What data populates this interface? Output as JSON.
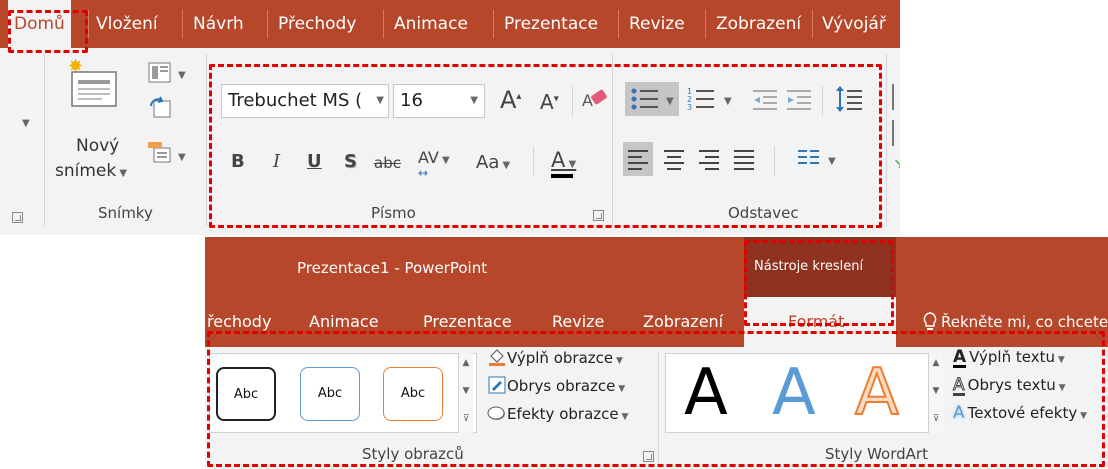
{
  "top": {
    "tabs": [
      "Domů",
      "Vložení",
      "Návrh",
      "Přechody",
      "Animace",
      "Prezentace",
      "Revize",
      "Zobrazení",
      "Vývojář"
    ],
    "slides_group": {
      "new_slide_line1": "Nový",
      "new_slide_line2": "snímek",
      "label": "Snímky"
    },
    "font_group": {
      "font_name": "Trebuchet MS (",
      "font_size": "16",
      "bold": "B",
      "italic": "I",
      "underline": "U",
      "shadow": "S",
      "strikethrough": "abc",
      "spacing": "AV",
      "change_case": "Aa",
      "font_color": "A",
      "grow": "A",
      "shrink": "A",
      "label": "Písmo"
    },
    "paragraph_group": {
      "label": "Odstavec"
    }
  },
  "bottom": {
    "window_title": "Prezentace1 - PowerPoint",
    "context_tab_group": "Nástroje kreslení",
    "tabs": [
      "řechody",
      "Animace",
      "Prezentace",
      "Revize",
      "Zobrazení"
    ],
    "format_tab": "Formát",
    "tell_me": "Řekněte mi, co chcete",
    "shape_styles": {
      "samples": [
        "Abc",
        "Abc",
        "Abc"
      ],
      "fill": "Výplň obrazce",
      "outline": "Obrys obrazce",
      "effects": "Efekty obrazce",
      "label": "Styly obrazců"
    },
    "wordart_styles": {
      "samples": [
        "A",
        "A",
        "A"
      ],
      "text_fill": "Výplň textu",
      "text_outline": "Obrys textu",
      "text_effects": "Textové efekty",
      "label": "Styly WordArt"
    }
  },
  "colors": {
    "ribbon_red": "#b7472a",
    "highlight": "#e00000",
    "ribbon_bg": "#f3f3f3",
    "blue_accent": "#5b9bd5",
    "orange_accent": "#ed7d31"
  }
}
